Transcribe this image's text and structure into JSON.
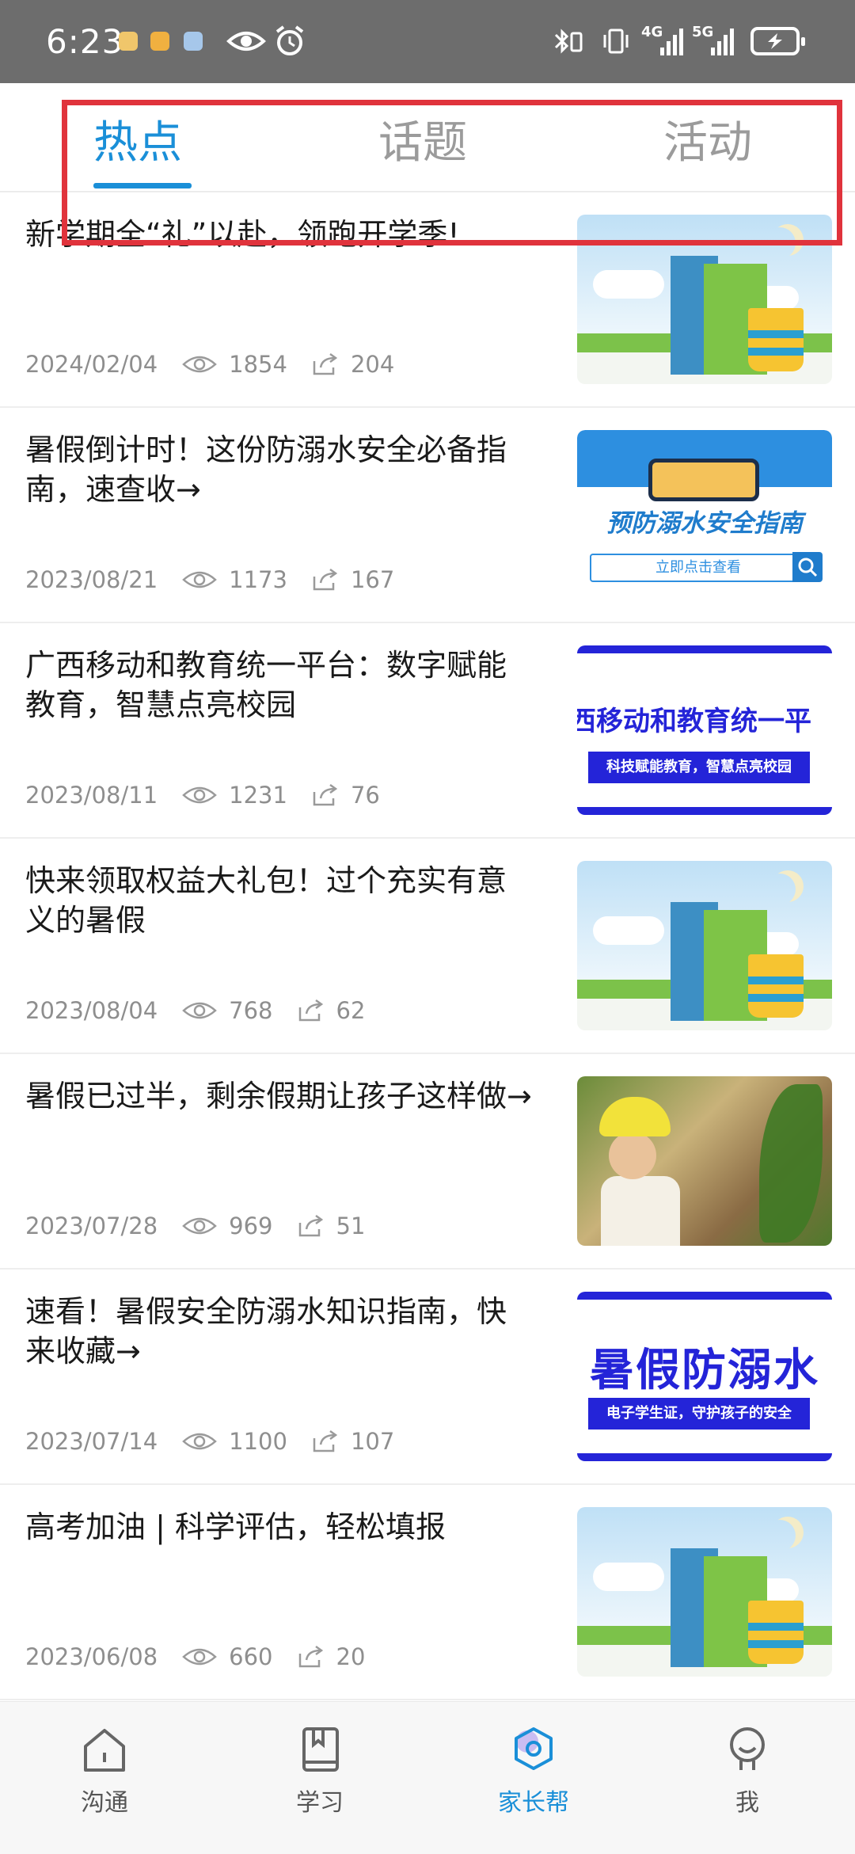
{
  "status_bar": {
    "time": "6:23",
    "network_4g": "4G",
    "network_5g": "5G"
  },
  "tabs": [
    {
      "label": "热点",
      "active": true
    },
    {
      "label": "话题",
      "active": false
    },
    {
      "label": "活动",
      "active": false
    }
  ],
  "articles": [
    {
      "title": "新学期全“礼”以赴，领跑开学季!",
      "date": "2024/02/04",
      "views": "1854",
      "shares": "204",
      "thumbnail": "books-illustration"
    },
    {
      "title": "暑假倒计时！这份防溺水安全必备指南，速查收→",
      "date": "2023/08/21",
      "views": "1173",
      "shares": "167",
      "thumbnail": "swim-safety-guide",
      "thumb_text": "预防溺水安全指南",
      "thumb_sub": "立即点击查看"
    },
    {
      "title": "广西移动和教育统一平台：数字赋能教育，智慧点亮校园",
      "date": "2023/08/11",
      "views": "1231",
      "shares": "76",
      "thumbnail": "platform-banner",
      "thumb_text": "西移动和教育统一平",
      "thumb_sub": "科技赋能教育，智慧点亮校园"
    },
    {
      "title": "快来领取权益大礼包！过个充实有意义的暑假",
      "date": "2023/08/04",
      "views": "768",
      "shares": "62",
      "thumbnail": "books-illustration"
    },
    {
      "title": "暑假已过半，剩余假期让孩子这样做→",
      "date": "2023/07/28",
      "views": "969",
      "shares": "51",
      "thumbnail": "child-photo"
    },
    {
      "title": "速看！暑假安全防溺水知识指南，快来收藏→",
      "date": "2023/07/14",
      "views": "1100",
      "shares": "107",
      "thumbnail": "drowning-banner",
      "thumb_text": "暑假防溺水",
      "thumb_sub": "电子学生证，守护孩子的安全"
    },
    {
      "title": "高考加油 | 科学评估，轻松填报",
      "date": "2023/06/08",
      "views": "660",
      "shares": "20",
      "thumbnail": "books-illustration"
    }
  ],
  "bottom_nav": [
    {
      "label": "沟通",
      "icon": "home-icon",
      "active": false
    },
    {
      "label": "学习",
      "icon": "book-icon",
      "active": false
    },
    {
      "label": "家长帮",
      "icon": "hexagon-icon",
      "active": true
    },
    {
      "label": "我",
      "icon": "user-icon",
      "active": false
    }
  ],
  "colors": {
    "accent": "#1a8fd8",
    "highlight_box": "#e0333c",
    "status_bar": "#6d6d6d"
  }
}
